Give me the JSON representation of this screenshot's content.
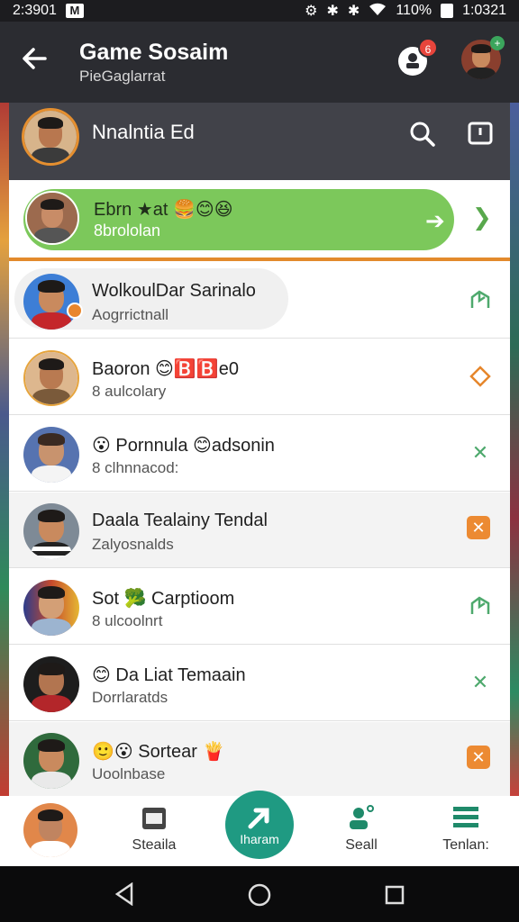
{
  "status": {
    "time": "2:3901",
    "notif_letter": "M",
    "battery": "110%",
    "clock_right": "1:0321"
  },
  "appbar": {
    "title": "Game Sosaim",
    "subtitle": "PieGaglarrat",
    "notif_count": "6"
  },
  "profile": {
    "name": "Nnalntia Ed"
  },
  "featured": {
    "name": "Ebrn ★at 🍔😊😆",
    "sub": "8brololan"
  },
  "rows": [
    {
      "name": "WolkoulDar Sarinalo",
      "sub": "Aogrrictnall",
      "action": "green-arrow"
    },
    {
      "name": "Baoron 😊🅱️🅱️e0",
      "sub": "8 aulcolary",
      "action": "orange-diamond"
    },
    {
      "name": "😮 Pornnula 😊adsonin",
      "sub": "8 clhnnacod:",
      "action": "green-x"
    },
    {
      "name": "Daala Tealainy Tendal",
      "sub": "Zalyosnalds",
      "action": "orange-x"
    },
    {
      "name": "Sot 🥦 Carptioom",
      "sub": "8 ulcoolnrt",
      "action": "green-arrow"
    },
    {
      "name": "😊 Da Liat Temaain",
      "sub": "Dorrlaratds",
      "action": "green-x"
    },
    {
      "name": "🙂😮 Sortear 🍟",
      "sub": "Uoolnbase",
      "action": "orange-x"
    }
  ],
  "bottomnav": {
    "item1": "Steaila",
    "fab": "Iharam",
    "item3": "Seall",
    "item4": "Tenlan:"
  },
  "colors": {
    "accent_green": "#7cc85b",
    "accent_orange": "#e38a2c",
    "fab": "#1f9a82"
  }
}
